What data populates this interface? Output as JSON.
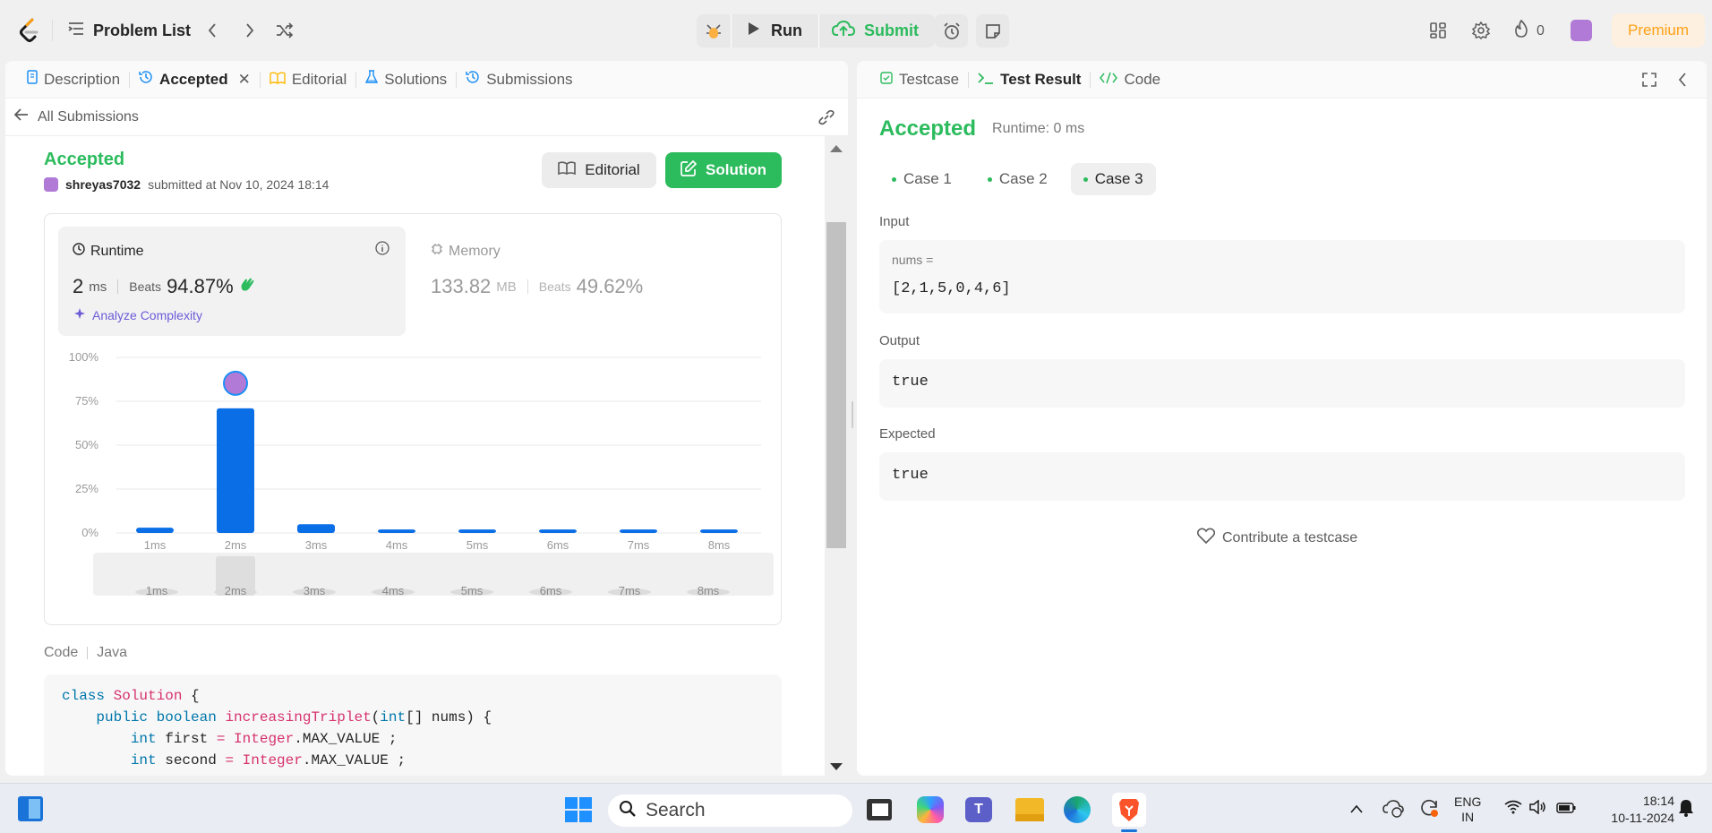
{
  "header": {
    "problem_list_label": "Problem List",
    "run_label": "Run",
    "submit_label": "Submit",
    "streak_count": "0",
    "premium_label": "Premium"
  },
  "left_tabs": [
    {
      "label": "Description"
    },
    {
      "label": "Accepted"
    },
    {
      "label": "Editorial"
    },
    {
      "label": "Solutions"
    },
    {
      "label": "Submissions"
    }
  ],
  "submission": {
    "back_label": "All Submissions",
    "status": "Accepted",
    "username": "shreyas7032",
    "submitted_text": "submitted at Nov 10, 2024 18:14",
    "editorial_button": "Editorial",
    "solution_button": "Solution",
    "runtime": {
      "title": "Runtime",
      "value": "2",
      "unit": "ms",
      "beats_label": "Beats",
      "beats_value": "94.87%",
      "analyze_label": "Analyze Complexity"
    },
    "memory": {
      "title": "Memory",
      "value": "133.82",
      "unit": "MB",
      "beats_label": "Beats",
      "beats_value": "49.62%"
    },
    "code_label": "Code",
    "language": "Java"
  },
  "chart_data": {
    "type": "bar",
    "categories": [
      "1ms",
      "2ms",
      "3ms",
      "4ms",
      "5ms",
      "6ms",
      "7ms",
      "8ms"
    ],
    "values": [
      3,
      71,
      5,
      2,
      2,
      2,
      2,
      2
    ],
    "highlight_index": 1,
    "ylim": [
      0,
      100
    ],
    "yticks": [
      "0%",
      "25%",
      "50%",
      "75%",
      "100%"
    ],
    "bar_color": "#0a6ee6",
    "grid": true
  },
  "code_lines": [
    [
      {
        "t": "class ",
        "c": "kw"
      },
      {
        "t": "Solution",
        "c": "kw2"
      },
      {
        "t": " {",
        "c": ""
      }
    ],
    [
      {
        "t": "    ",
        "c": ""
      },
      {
        "t": "public ",
        "c": "kw"
      },
      {
        "t": "boolean ",
        "c": "kw"
      },
      {
        "t": "increasingTriplet",
        "c": "kw2"
      },
      {
        "t": "(",
        "c": ""
      },
      {
        "t": "int",
        "c": "kw"
      },
      {
        "t": "[] nums) {",
        "c": ""
      }
    ],
    [
      {
        "t": "        ",
        "c": ""
      },
      {
        "t": "int ",
        "c": "kw"
      },
      {
        "t": "first ",
        "c": ""
      },
      {
        "t": "= ",
        "c": "op"
      },
      {
        "t": "Integer",
        "c": "kw2"
      },
      {
        "t": ".MAX_VALUE ;",
        "c": ""
      }
    ],
    [
      {
        "t": "        ",
        "c": ""
      },
      {
        "t": "int ",
        "c": "kw"
      },
      {
        "t": "second ",
        "c": ""
      },
      {
        "t": "= ",
        "c": "op"
      },
      {
        "t": "Integer",
        "c": "kw2"
      },
      {
        "t": ".MAX_VALUE ;",
        "c": ""
      }
    ]
  ],
  "right_tabs": [
    {
      "label": "Testcase"
    },
    {
      "label": "Test Result"
    },
    {
      "label": "Code"
    }
  ],
  "result": {
    "status": "Accepted",
    "runtime_text": "Runtime: 0 ms",
    "cases": [
      {
        "label": "Case 1"
      },
      {
        "label": "Case 2"
      },
      {
        "label": "Case 3"
      }
    ],
    "input_label": "Input",
    "input_var": "nums =",
    "input_value": "[2,1,5,0,4,6]",
    "output_label": "Output",
    "output_value": "true",
    "expected_label": "Expected",
    "expected_value": "true",
    "contribute_label": "Contribute a testcase"
  },
  "taskbar": {
    "search_placeholder": "Search",
    "lang_top": "ENG",
    "lang_bottom": "IN",
    "time": "18:14",
    "date": "10-11-2024"
  }
}
